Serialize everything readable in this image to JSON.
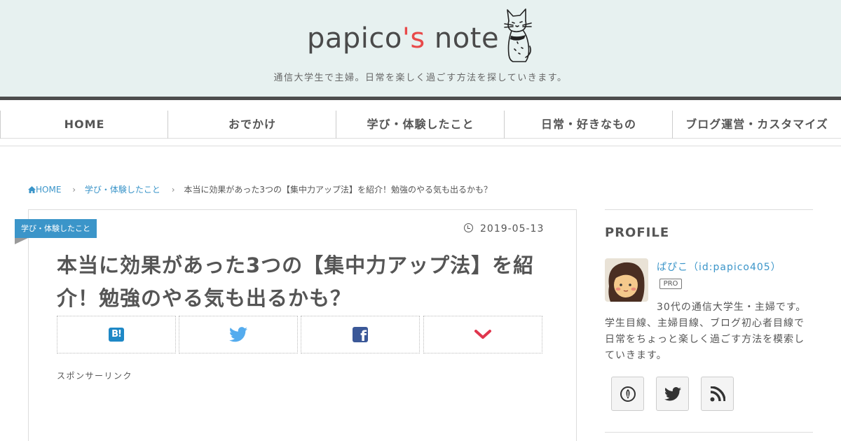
{
  "header": {
    "logo_main": "papico",
    "logo_accent": "'s",
    "logo_end": " note",
    "tagline": "通信大学生で主婦。日常を楽しく過ごす方法を探していきます。"
  },
  "nav": {
    "items": [
      {
        "label": "HOME"
      },
      {
        "label": "おでかけ"
      },
      {
        "label": "学び・体験したこと"
      },
      {
        "label": "日常・好きなもの"
      },
      {
        "label": "ブログ運営・カスタマイズ"
      }
    ]
  },
  "breadcrumb": {
    "home": "HOME",
    "category": "学び・体験したこと",
    "current": "本当に効果があった3つの【集中力アップ法】を紹介！勉強のやる気も出るかも？"
  },
  "article": {
    "category_label": "学び・体験したこと",
    "date": "2019-05-13",
    "title": "本当に効果があった3つの【集中力アップ法】を紹介！勉強のやる気も出るかも？",
    "hatena_label": "B!",
    "facebook_label": "f",
    "sponsor_text": "スポンサーリンク"
  },
  "sidebar": {
    "profile_heading": "PROFILE",
    "profile_name": "ぱぴこ（id:papico405）",
    "pro_badge": "PRO",
    "profile_desc": "30代の通信大学生・主婦です。学生目線、主婦目線、ブログ初心者目線で日常をちょっと楽しく過ごす方法を模索していきます。"
  },
  "icons": {
    "home": "home-icon",
    "clock": "clock-icon",
    "hatena": "hatena-bookmark-icon",
    "twitter": "twitter-bird-icon",
    "facebook": "facebook-icon",
    "more": "chevron-down-icon",
    "feedly": "feedly-icon",
    "rss": "rss-icon"
  },
  "colors": {
    "header_bg": "#e7f1f0",
    "accent_red": "#e84a4a",
    "link_blue": "#3b95c9",
    "twitter_blue": "#55acee",
    "facebook_blue": "#3b5898",
    "chevron_red": "#e0364e"
  }
}
